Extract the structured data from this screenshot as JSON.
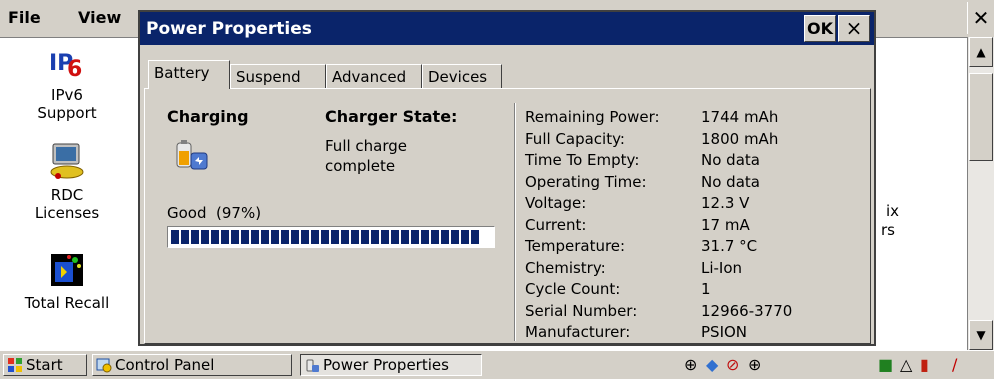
{
  "menubar": {
    "file_label": "File",
    "view_label": "View"
  },
  "background": {
    "icons": [
      {
        "label_line1": "IPv6",
        "label_line2": "Support"
      },
      {
        "label_line1": "RDC",
        "label_line2": "Licenses"
      },
      {
        "label_line1": "Total Recall",
        "label_line2": ""
      }
    ],
    "partial_right_1": "ix",
    "partial_right_2": "rs",
    "ipv6_logo_text": "IPv6"
  },
  "dialog": {
    "title": "Power Properties",
    "ok_label": "OK",
    "close_label": "×",
    "tabs": [
      "Battery",
      "Suspend",
      "Advanced",
      "Devices"
    ],
    "charging_label": "Charging",
    "charger_state_label": "Charger State:",
    "charger_state_value_line1": "Full charge",
    "charger_state_value_line2": "complete",
    "battery_status": "Good  (97%)",
    "battery_percent": 97,
    "stats": [
      {
        "key": "Remaining Power:",
        "value": "1744 mAh"
      },
      {
        "key": "Full Capacity:",
        "value": "1800 mAh"
      },
      {
        "key": "Time To Empty:",
        "value": "No data"
      },
      {
        "key": "Operating Time:",
        "value": "No data"
      },
      {
        "key": "Voltage:",
        "value": "12.3 V"
      },
      {
        "key": "Current:",
        "value": "17 mA"
      },
      {
        "key": "Temperature:",
        "value": "31.7 °C"
      },
      {
        "key": "Chemistry:",
        "value": "Li-Ion"
      },
      {
        "key": "Cycle Count:",
        "value": "1"
      },
      {
        "key": "Serial Number:",
        "value": "12966-3770"
      },
      {
        "key": "Manufacturer:",
        "value": "PSION"
      }
    ]
  },
  "taskbar": {
    "start_label": "Start",
    "items": [
      "Control Panel",
      "Power Properties"
    ]
  },
  "colors": {
    "titlebar": "#0a246a",
    "face": "#d4d0c8",
    "progress": "#0a246a"
  }
}
